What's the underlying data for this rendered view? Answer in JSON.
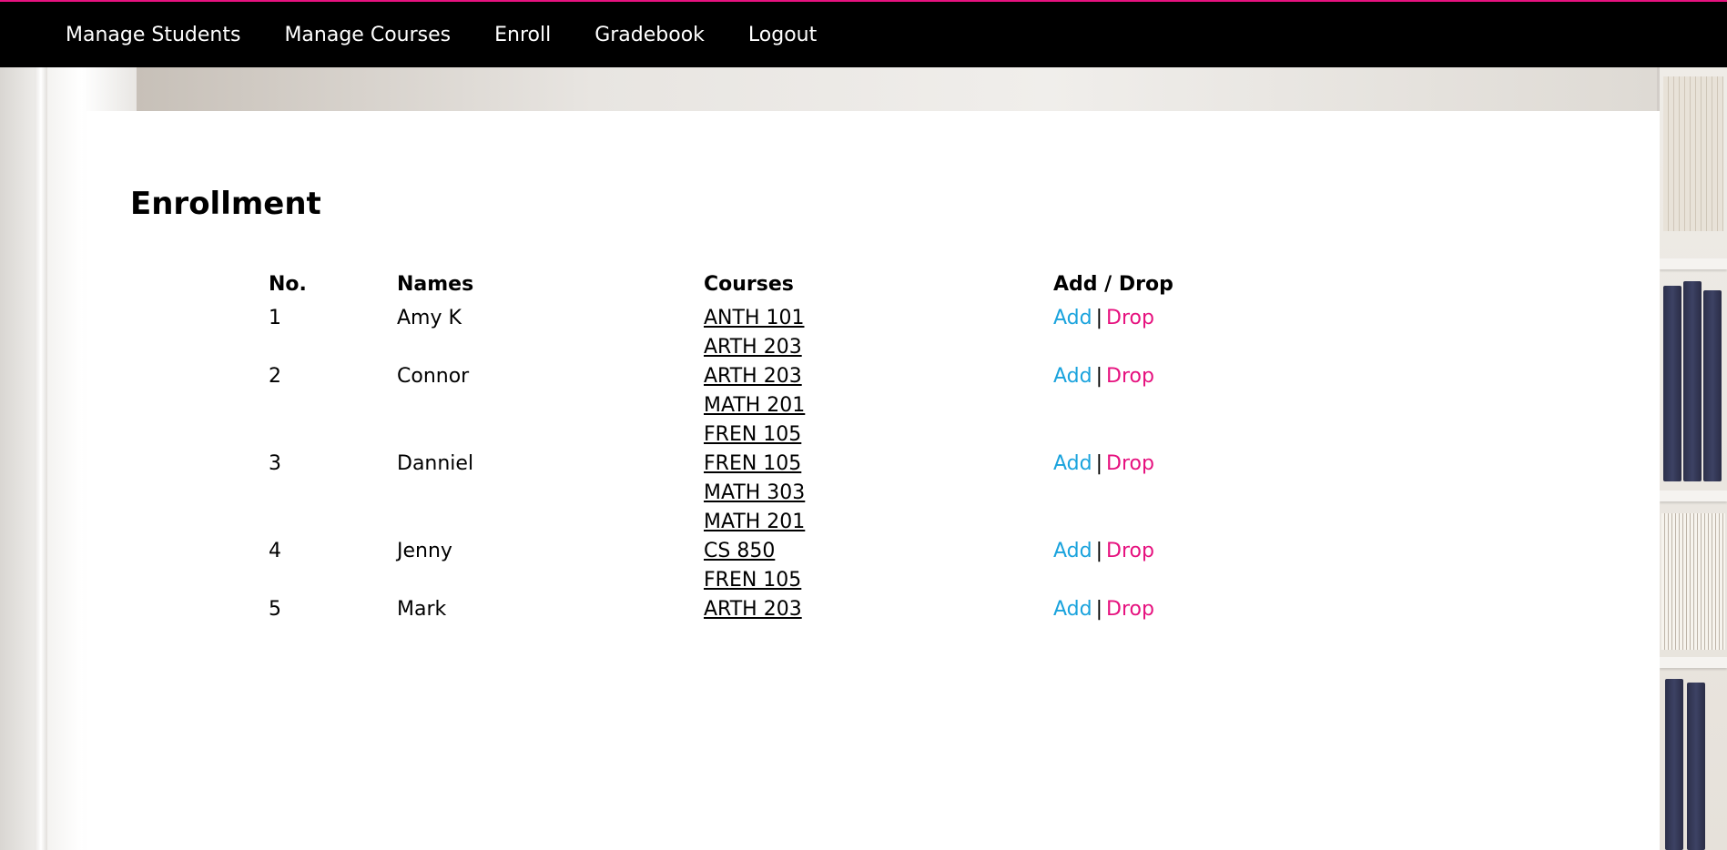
{
  "nav": {
    "items": [
      "Manage Students",
      "Manage Courses",
      "Enroll",
      "Gradebook",
      "Logout"
    ]
  },
  "page": {
    "title": "Enrollment"
  },
  "table": {
    "headers": {
      "no": "No.",
      "names": "Names",
      "courses": "Courses",
      "actions": "Add / Drop"
    },
    "rows": [
      {
        "no": "1",
        "name": "Amy K",
        "courses": [
          "ANTH 101",
          "ARTH 203"
        ],
        "add": "Add",
        "sep": "|",
        "drop": "Drop"
      },
      {
        "no": "2",
        "name": "Connor",
        "courses": [
          "ARTH 203",
          "MATH 201",
          "FREN 105"
        ],
        "add": "Add",
        "sep": "|",
        "drop": "Drop"
      },
      {
        "no": "3",
        "name": "Danniel",
        "courses": [
          "FREN 105",
          "MATH 303",
          "MATH 201"
        ],
        "add": "Add",
        "sep": "|",
        "drop": "Drop"
      },
      {
        "no": "4",
        "name": "Jenny",
        "courses": [
          "CS 850",
          "FREN 105"
        ],
        "add": "Add",
        "sep": "|",
        "drop": "Drop"
      },
      {
        "no": "5",
        "name": "Mark",
        "courses": [
          "ARTH 203"
        ],
        "add": "Add",
        "sep": "|",
        "drop": "Drop"
      }
    ]
  },
  "colors": {
    "nav_bg": "#000000",
    "accent_pink": "#e6127f",
    "add_blue": "#1aa3dd"
  }
}
